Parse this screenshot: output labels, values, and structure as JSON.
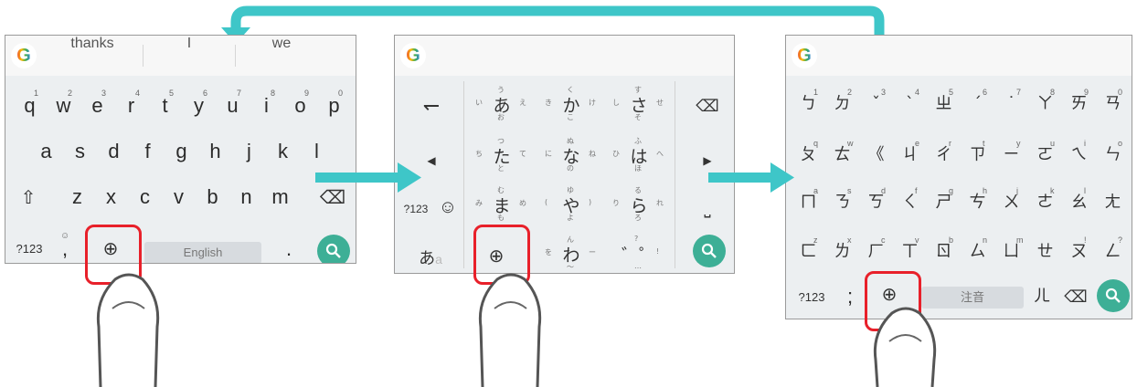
{
  "colors": {
    "accent": "#3daf96",
    "highlight": "#e8202a",
    "arrow": "#3ec6c8",
    "keyboard_bg": "#eceff1"
  },
  "panel1": {
    "suggestions": [
      "thanks",
      "I",
      "we"
    ],
    "row1": [
      [
        "q",
        "1"
      ],
      [
        "w",
        "2"
      ],
      [
        "e",
        "3"
      ],
      [
        "r",
        "4"
      ],
      [
        "t",
        "5"
      ],
      [
        "y",
        "6"
      ],
      [
        "u",
        "7"
      ],
      [
        "i",
        "8"
      ],
      [
        "o",
        "9"
      ],
      [
        "p",
        "0"
      ]
    ],
    "row2": [
      "a",
      "s",
      "d",
      "f",
      "g",
      "h",
      "j",
      "k",
      "l"
    ],
    "row3": [
      "z",
      "x",
      "c",
      "v",
      "b",
      "n",
      "m"
    ],
    "shift_glyph": "⇧",
    "backspace_glyph": "⌫",
    "symbols_label": "?123",
    "comma_label": ",",
    "emoji_glyph": "☺",
    "globe_glyph": "⊕",
    "space_label": "English",
    "period_label": "."
  },
  "panel2": {
    "undo_glyph": "↽",
    "left_glyph": "◀",
    "symbols_label": "?123",
    "emoji_glyph": "☺",
    "kana_toggle": "あ",
    "kana_toggle_sub": "a",
    "globe_glyph": "⊕",
    "backspace_glyph": "⌫",
    "right_glyph": "▶",
    "space_glyph": "⎵",
    "keys": [
      {
        "main": "あ",
        "t": "う",
        "l": "い",
        "r": "え",
        "b": "お"
      },
      {
        "main": "か",
        "t": "く",
        "l": "き",
        "r": "け",
        "b": "こ"
      },
      {
        "main": "さ",
        "t": "す",
        "l": "し",
        "r": "せ",
        "b": "そ"
      },
      {
        "main": "た",
        "t": "つ",
        "l": "ち",
        "r": "て",
        "b": "と"
      },
      {
        "main": "な",
        "t": "ぬ",
        "l": "に",
        "r": "ね",
        "b": "の"
      },
      {
        "main": "は",
        "t": "ふ",
        "l": "ひ",
        "r": "へ",
        "b": "ほ"
      },
      {
        "main": "ま",
        "t": "む",
        "l": "み",
        "r": "め",
        "b": "も"
      },
      {
        "main": "や",
        "t": "ゆ",
        "l": "(",
        "r": ")",
        "b": "よ"
      },
      {
        "main": "ら",
        "t": "る",
        "l": "り",
        "r": "れ",
        "b": "ろ"
      },
      {
        "main": "わ",
        "t": "ん",
        "l": "を",
        "r": "ー",
        "b": "〜"
      },
      {
        "main": "゛゜",
        "t": "?",
        "l": "",
        "r": "!",
        "b": "…"
      }
    ]
  },
  "panel3": {
    "row1": [
      [
        "ㄅ",
        "1"
      ],
      [
        "ㄉ",
        "2"
      ],
      [
        "ˇ",
        "3"
      ],
      [
        "ˋ",
        "4"
      ],
      [
        "ㄓ",
        "5"
      ],
      [
        "ˊ",
        "6"
      ],
      [
        "˙",
        "7"
      ],
      [
        "ㄚ",
        "8"
      ],
      [
        "ㄞ",
        "9"
      ],
      [
        "ㄢ",
        "0"
      ]
    ],
    "row2": [
      [
        "ㄆ",
        "q"
      ],
      [
        "ㄊ",
        "w"
      ],
      [
        "《",
        ""
      ],
      [
        "ㄐ",
        "e"
      ],
      [
        "ㄔ",
        "r"
      ],
      [
        "ㄗ",
        "t"
      ],
      [
        "ㄧ",
        "y"
      ],
      [
        "ㄛ",
        "u"
      ],
      [
        "ㄟ",
        "i"
      ],
      [
        "ㄣ",
        "o"
      ]
    ],
    "row3": [
      [
        "ㄇ",
        "a"
      ],
      [
        "ㄋ",
        "s"
      ],
      [
        "ㄎ",
        "d"
      ],
      [
        "ㄑ",
        "f"
      ],
      [
        "ㄕ",
        "g"
      ],
      [
        "ㄘ",
        "h"
      ],
      [
        "ㄨ",
        "j"
      ],
      [
        "ㄜ",
        "k"
      ],
      [
        "ㄠ",
        "l"
      ],
      [
        "ㄤ",
        ""
      ]
    ],
    "row4": [
      [
        "ㄈ",
        "z"
      ],
      [
        "ㄌ",
        "x"
      ],
      [
        "ㄏ",
        "c"
      ],
      [
        "ㄒ",
        "v"
      ],
      [
        "ㄖ",
        "b"
      ],
      [
        "ㄙ",
        "n"
      ],
      [
        "ㄩ",
        "m"
      ],
      [
        "ㄝ",
        ""
      ],
      [
        "ㄡ",
        "!"
      ],
      [
        "ㄥ",
        "?"
      ]
    ],
    "symbols_label": "?123",
    "semicolon_label": ";",
    "globe_glyph": "⊕",
    "space_label": "注音",
    "er_label": "ㄦ",
    "backspace_glyph": "⌫"
  }
}
